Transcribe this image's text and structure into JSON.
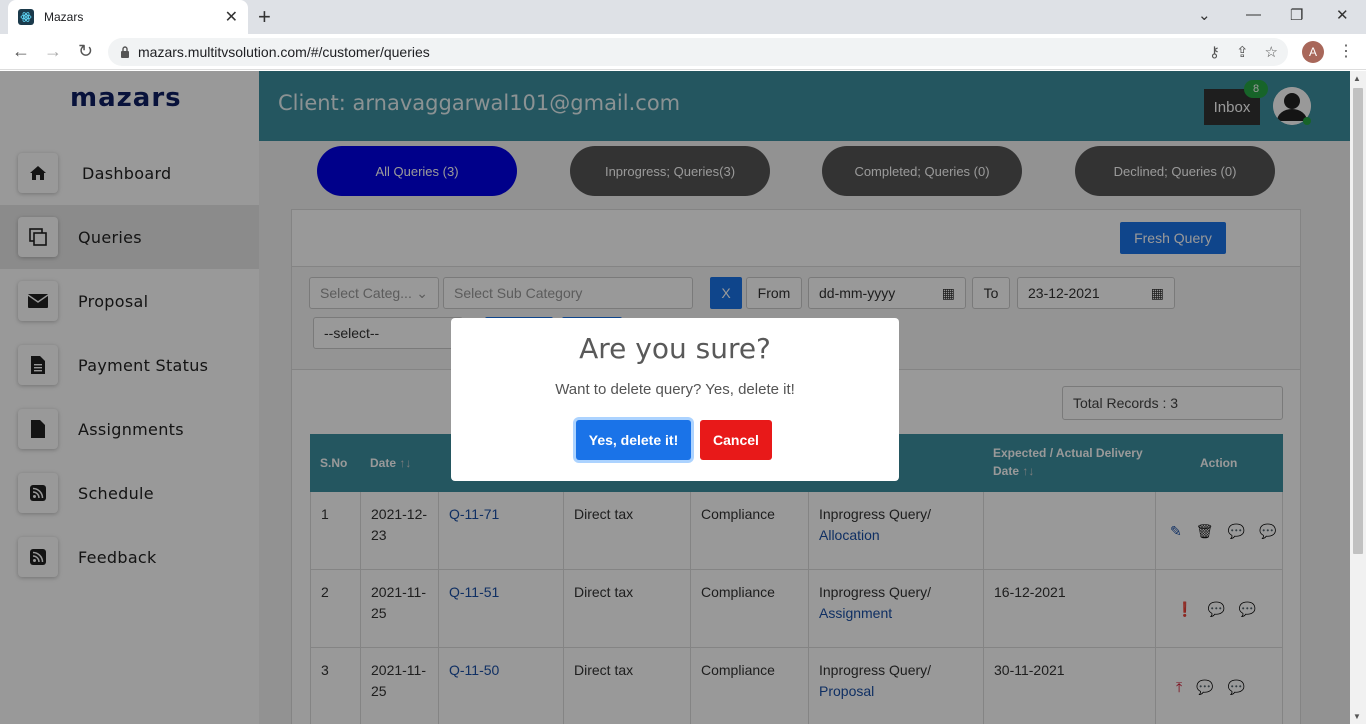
{
  "browser": {
    "tab_title": "Mazars",
    "url": "mazars.multitvsolution.com/#/customer/queries",
    "profile_initial": "A"
  },
  "sidebar": {
    "logo": "mazars",
    "items": [
      {
        "label": "Dashboard",
        "icon": "home-icon"
      },
      {
        "label": "Queries",
        "icon": "copy-icon"
      },
      {
        "label": "Proposal",
        "icon": "envelope-icon"
      },
      {
        "label": "Payment Status",
        "icon": "document-icon"
      },
      {
        "label": "Assignments",
        "icon": "file-icon"
      },
      {
        "label": "Schedule",
        "icon": "rss-icon"
      },
      {
        "label": "Feedback",
        "icon": "rss-icon"
      }
    ]
  },
  "header": {
    "client": "Client: arnavaggarwal101@gmail.com",
    "inbox_label": "Inbox",
    "inbox_count": "8"
  },
  "tabs": [
    {
      "label": "All Queries (3)",
      "active": true
    },
    {
      "label": "Inprogress; Queries(3)",
      "active": false
    },
    {
      "label": "Completed; Queries (0)",
      "active": false
    },
    {
      "label": "Declined; Queries (0)",
      "active": false
    }
  ],
  "toolbar": {
    "fresh_query": "Fresh Query"
  },
  "filters": {
    "category_placeholder": "Select Categ...",
    "subcategory_placeholder": "Select Sub Category",
    "clear_label": "X",
    "from_label": "From",
    "from_date": "dd-mm-yyyy",
    "to_label": "To",
    "to_date": "23-12-2021",
    "select_label": "--select--"
  },
  "total_records": "Total Records : 3",
  "table": {
    "headers": [
      "S.No",
      "Date",
      "",
      "",
      "",
      "",
      "Expected / Actual Delivery Date",
      "Action"
    ],
    "rows": [
      {
        "sno": "1",
        "date": "2021-12-23",
        "query": "Q-11-71",
        "category": "Direct tax",
        "subcategory": "Compliance",
        "status": "Inprogress Query/",
        "stage": "Allocation",
        "delivery": ""
      },
      {
        "sno": "2",
        "date": "2021-11-25",
        "query": "Q-11-51",
        "category": "Direct tax",
        "subcategory": "Compliance",
        "status": "Inprogress Query/",
        "stage": "Assignment",
        "delivery": "16-12-2021"
      },
      {
        "sno": "3",
        "date": "2021-11-25",
        "query": "Q-11-50",
        "category": "Direct tax",
        "subcategory": "Compliance",
        "status": "Inprogress Query/",
        "stage": "Proposal",
        "delivery": "30-11-2021"
      }
    ]
  },
  "modal": {
    "title": "Are you sure?",
    "text": "Want to delete query? Yes, delete it!",
    "confirm": "Yes, delete it!",
    "cancel": "Cancel"
  }
}
